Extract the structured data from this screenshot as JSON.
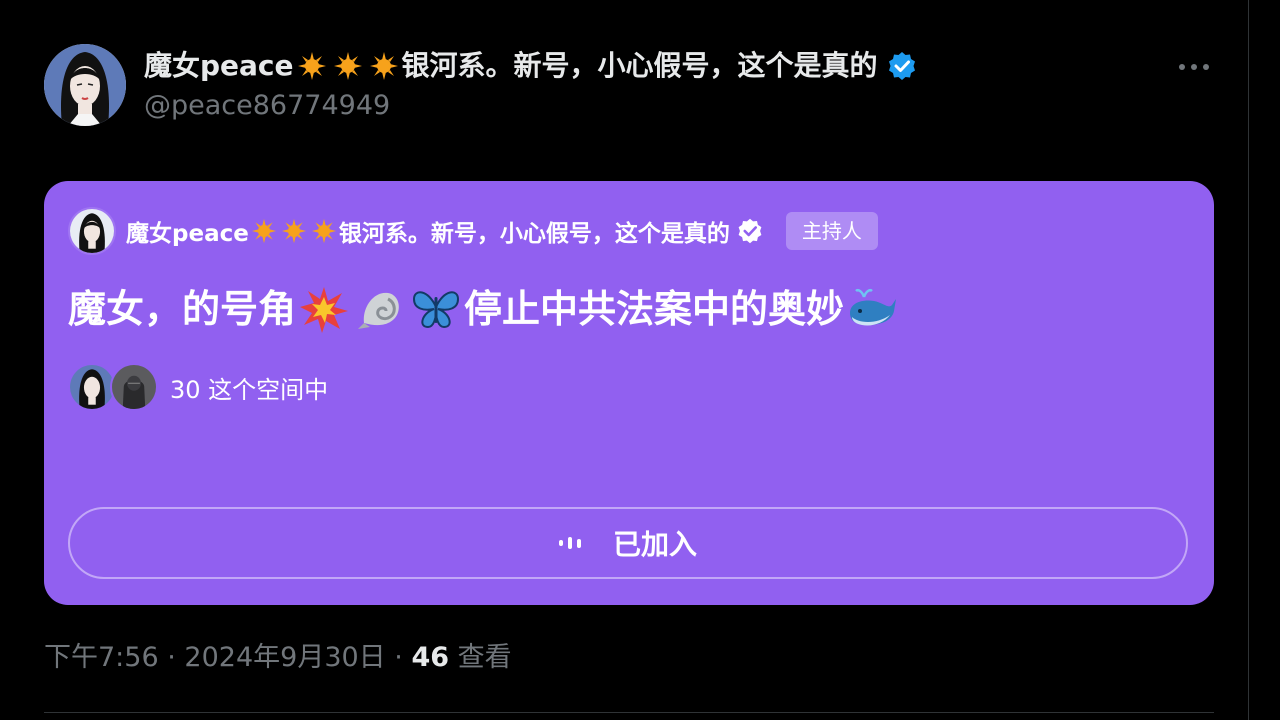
{
  "author": {
    "display_name_prefix": "魔女peace",
    "display_name_suffix": "银河系。新号，小心假号，这个是真的",
    "handle": "@peace86774949",
    "verified": true,
    "avatar_icon": "woman-portrait-avatar"
  },
  "more_menu_icon": "ellipsis-icon",
  "space": {
    "background_color": "#9160f0",
    "host": {
      "name_prefix": "魔女peace",
      "name_suffix": "银河系。新号，小心假号，这个是真的",
      "badge": "主持人"
    },
    "title_part1": "魔女，的号角",
    "title_part2": "停止中共法案中的奥妙",
    "title_emojis": [
      "collision-icon",
      "spiral-shell-icon",
      "butterfly-icon",
      "whale-icon"
    ],
    "listener_count_text": "30 这个空间中",
    "joined_button_label": "已加入"
  },
  "meta": {
    "time": "下午7:56",
    "separator": "·",
    "date": "2024年9月30日",
    "views_count": "46",
    "views_label": "查看"
  },
  "colors": {
    "background": "#000000",
    "text_primary": "#e7e9ea",
    "text_secondary": "#71767b",
    "verified_blue": "#1d9bf0",
    "space_purple": "#9160f0"
  }
}
